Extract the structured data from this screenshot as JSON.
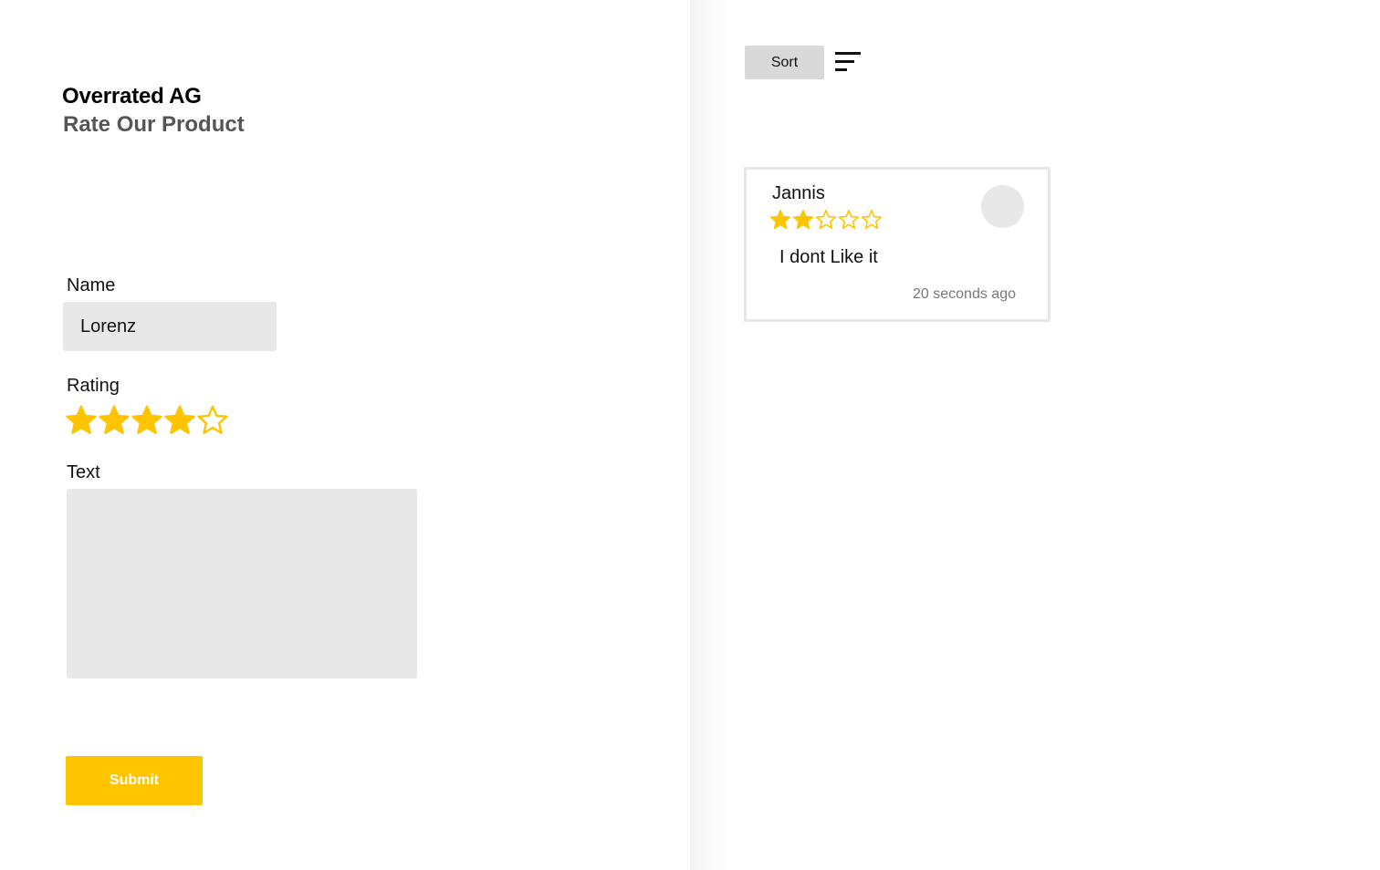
{
  "header": {
    "brand": "Overrated AG",
    "subtitle": "Rate Our Product"
  },
  "form": {
    "name_label": "Name",
    "name_value": "Lorenz",
    "rating_label": "Rating",
    "rating_value": 4,
    "rating_max": 5,
    "text_label": "Text",
    "text_value": "",
    "submit_label": "Submit"
  },
  "toolbar": {
    "sort_label": "Sort",
    "sort_icon": "sort-lines-icon"
  },
  "reviews": [
    {
      "author": "Jannis",
      "rating": 2,
      "rating_max": 5,
      "text": "I dont Like it",
      "time": "20 seconds ago"
    }
  ],
  "colors": {
    "accent": "#ffc400",
    "field_bg": "#e8e8e8",
    "sort_bg": "#d9d9d9",
    "card_border": "#e6e6e6"
  }
}
